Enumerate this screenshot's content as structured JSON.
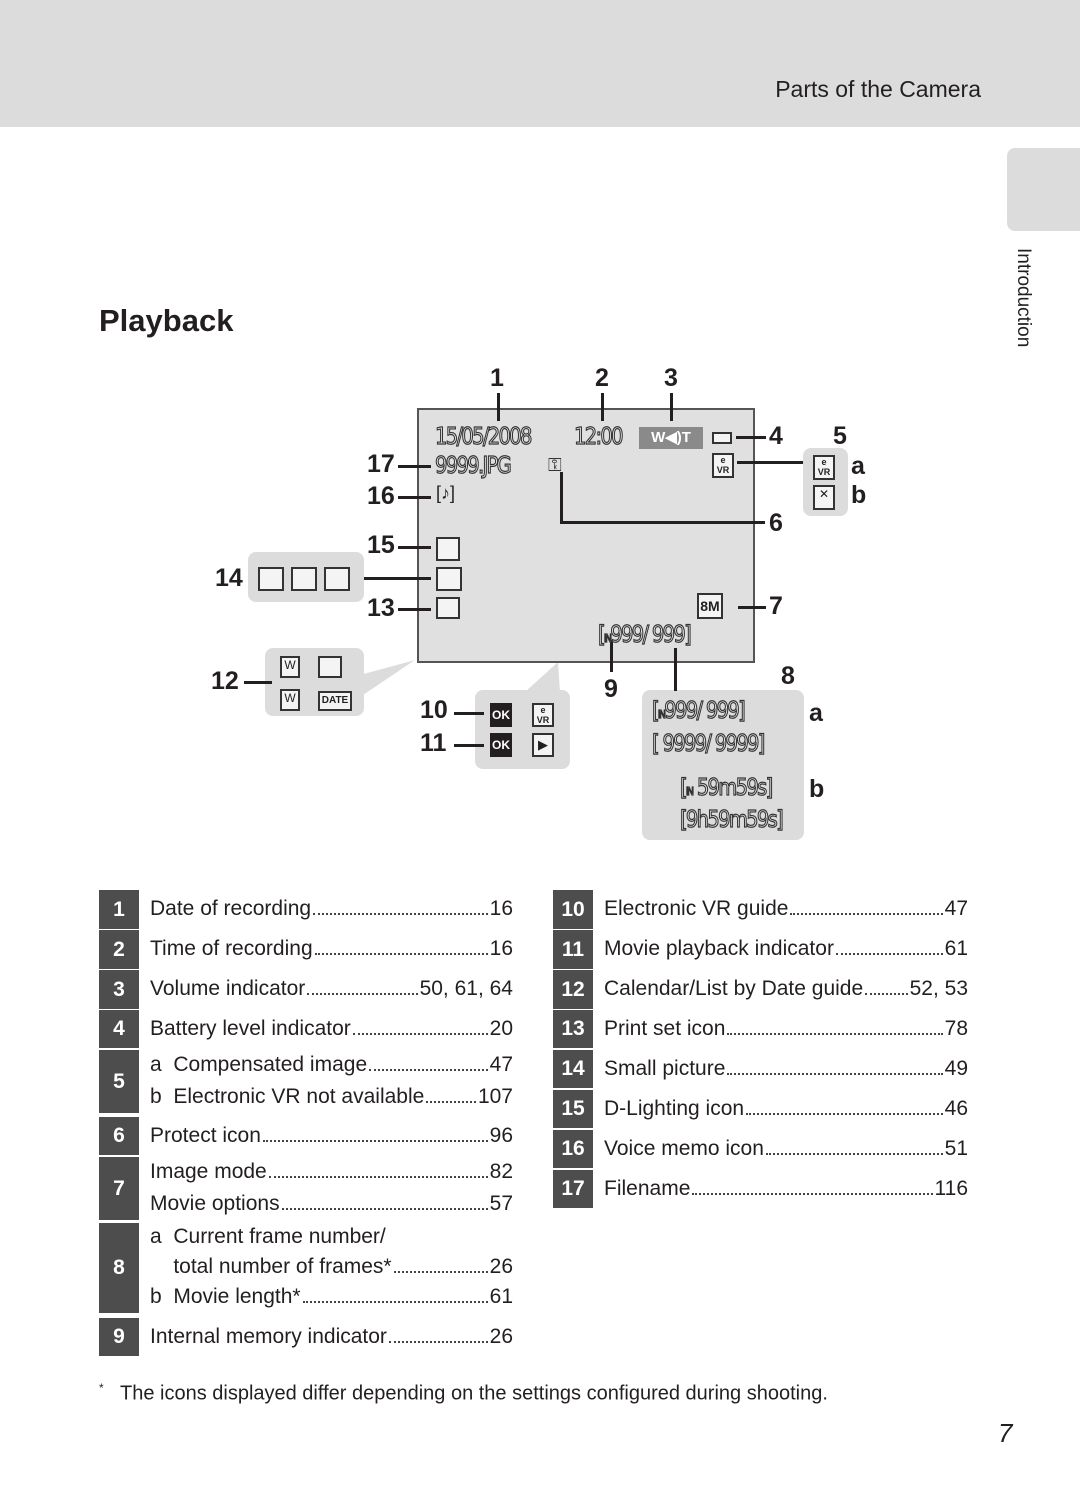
{
  "header": {
    "section_title": "Parts of the Camera"
  },
  "side_tab": {
    "label": "Introduction"
  },
  "page_title": "Playback",
  "diagram": {
    "callouts": [
      "1",
      "2",
      "3",
      "4",
      "5",
      "6",
      "7",
      "8",
      "9",
      "10",
      "11",
      "12",
      "13",
      "14",
      "15",
      "16",
      "17"
    ],
    "sub_labels": {
      "a": "a",
      "b": "b"
    },
    "screen": {
      "date": "15/05/2008",
      "time": "12:00",
      "filename": "9999.JPG",
      "frame_counter": "999/  999",
      "image_mode": "8M",
      "volume": "W◀)T"
    },
    "panel8": {
      "a1": "999/  999",
      "a2": "9999/ 9999",
      "b1": "59m59s",
      "b2": "9h59m59s",
      "memory": "IN"
    },
    "panel10": {
      "ok": "OK"
    },
    "panel12": {
      "date": "DATE"
    }
  },
  "legend_left": [
    {
      "num": "1",
      "lines": [
        {
          "label": "Date of recording",
          "page": "16"
        }
      ]
    },
    {
      "num": "2",
      "lines": [
        {
          "label": "Time of recording",
          "page": "16"
        }
      ]
    },
    {
      "num": "3",
      "lines": [
        {
          "label": "Volume indicator",
          "page": "50, 61, 64"
        }
      ]
    },
    {
      "num": "4",
      "lines": [
        {
          "label": "Battery level indicator",
          "page": "20"
        }
      ]
    },
    {
      "num": "5",
      "lines": [
        {
          "label": "a  Compensated image",
          "page": "47"
        },
        {
          "label": "b  Electronic VR not available",
          "page": "107"
        }
      ]
    },
    {
      "num": "6",
      "lines": [
        {
          "label": "Protect icon",
          "page": "96"
        }
      ]
    },
    {
      "num": "7",
      "lines": [
        {
          "label": "Image mode",
          "page": "82"
        },
        {
          "label": "Movie options",
          "page": "57"
        }
      ]
    },
    {
      "num": "8",
      "lines": [
        {
          "label": "a  Current frame number/",
          "page": ""
        },
        {
          "label": "    total number of frames*",
          "page": "26"
        },
        {
          "label": "b  Movie length*",
          "page": "61"
        }
      ]
    },
    {
      "num": "9",
      "lines": [
        {
          "label": "Internal memory indicator",
          "page": "26"
        }
      ]
    }
  ],
  "legend_right": [
    {
      "num": "10",
      "lines": [
        {
          "label": "Electronic VR guide",
          "page": "47"
        }
      ]
    },
    {
      "num": "11",
      "lines": [
        {
          "label": "Movie playback indicator",
          "page": "61"
        }
      ]
    },
    {
      "num": "12",
      "lines": [
        {
          "label": "Calendar/List by Date guide",
          "page": "52, 53"
        }
      ]
    },
    {
      "num": "13",
      "lines": [
        {
          "label": "Print set icon",
          "page": "78"
        }
      ]
    },
    {
      "num": "14",
      "lines": [
        {
          "label": "Small picture",
          "page": "49"
        }
      ]
    },
    {
      "num": "15",
      "lines": [
        {
          "label": "D-Lighting icon",
          "page": "46"
        }
      ]
    },
    {
      "num": "16",
      "lines": [
        {
          "label": "Voice memo icon",
          "page": "51"
        }
      ]
    },
    {
      "num": "17",
      "lines": [
        {
          "label": "Filename",
          "page": "116"
        }
      ]
    }
  ],
  "footnote": {
    "mark": "*",
    "text": "The icons displayed differ depending on the settings configured during shooting."
  },
  "page_number": "7",
  "colors": {
    "header_bg": "#dcdcdc",
    "badge_bg": "#4d4d4d",
    "screen_bg": "#e0e0e0"
  }
}
